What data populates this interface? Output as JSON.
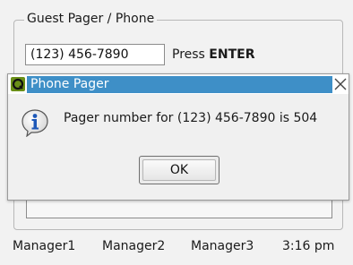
{
  "group": {
    "legend": "Guest Pager / Phone",
    "phone_value": "(123) 456-7890",
    "press_label": "Press ",
    "press_key": "ENTER"
  },
  "dialog": {
    "title": "Phone Pager",
    "message": "Pager number for (123) 456-7890 is 504",
    "ok_label": "OK",
    "close_glyph": "✕",
    "icon": "info-icon",
    "titlebar_color": "#3e8fc7"
  },
  "bottom_bar": {
    "items": [
      "Manager1",
      "Manager2",
      "Manager3"
    ],
    "time": "3:16 pm"
  }
}
